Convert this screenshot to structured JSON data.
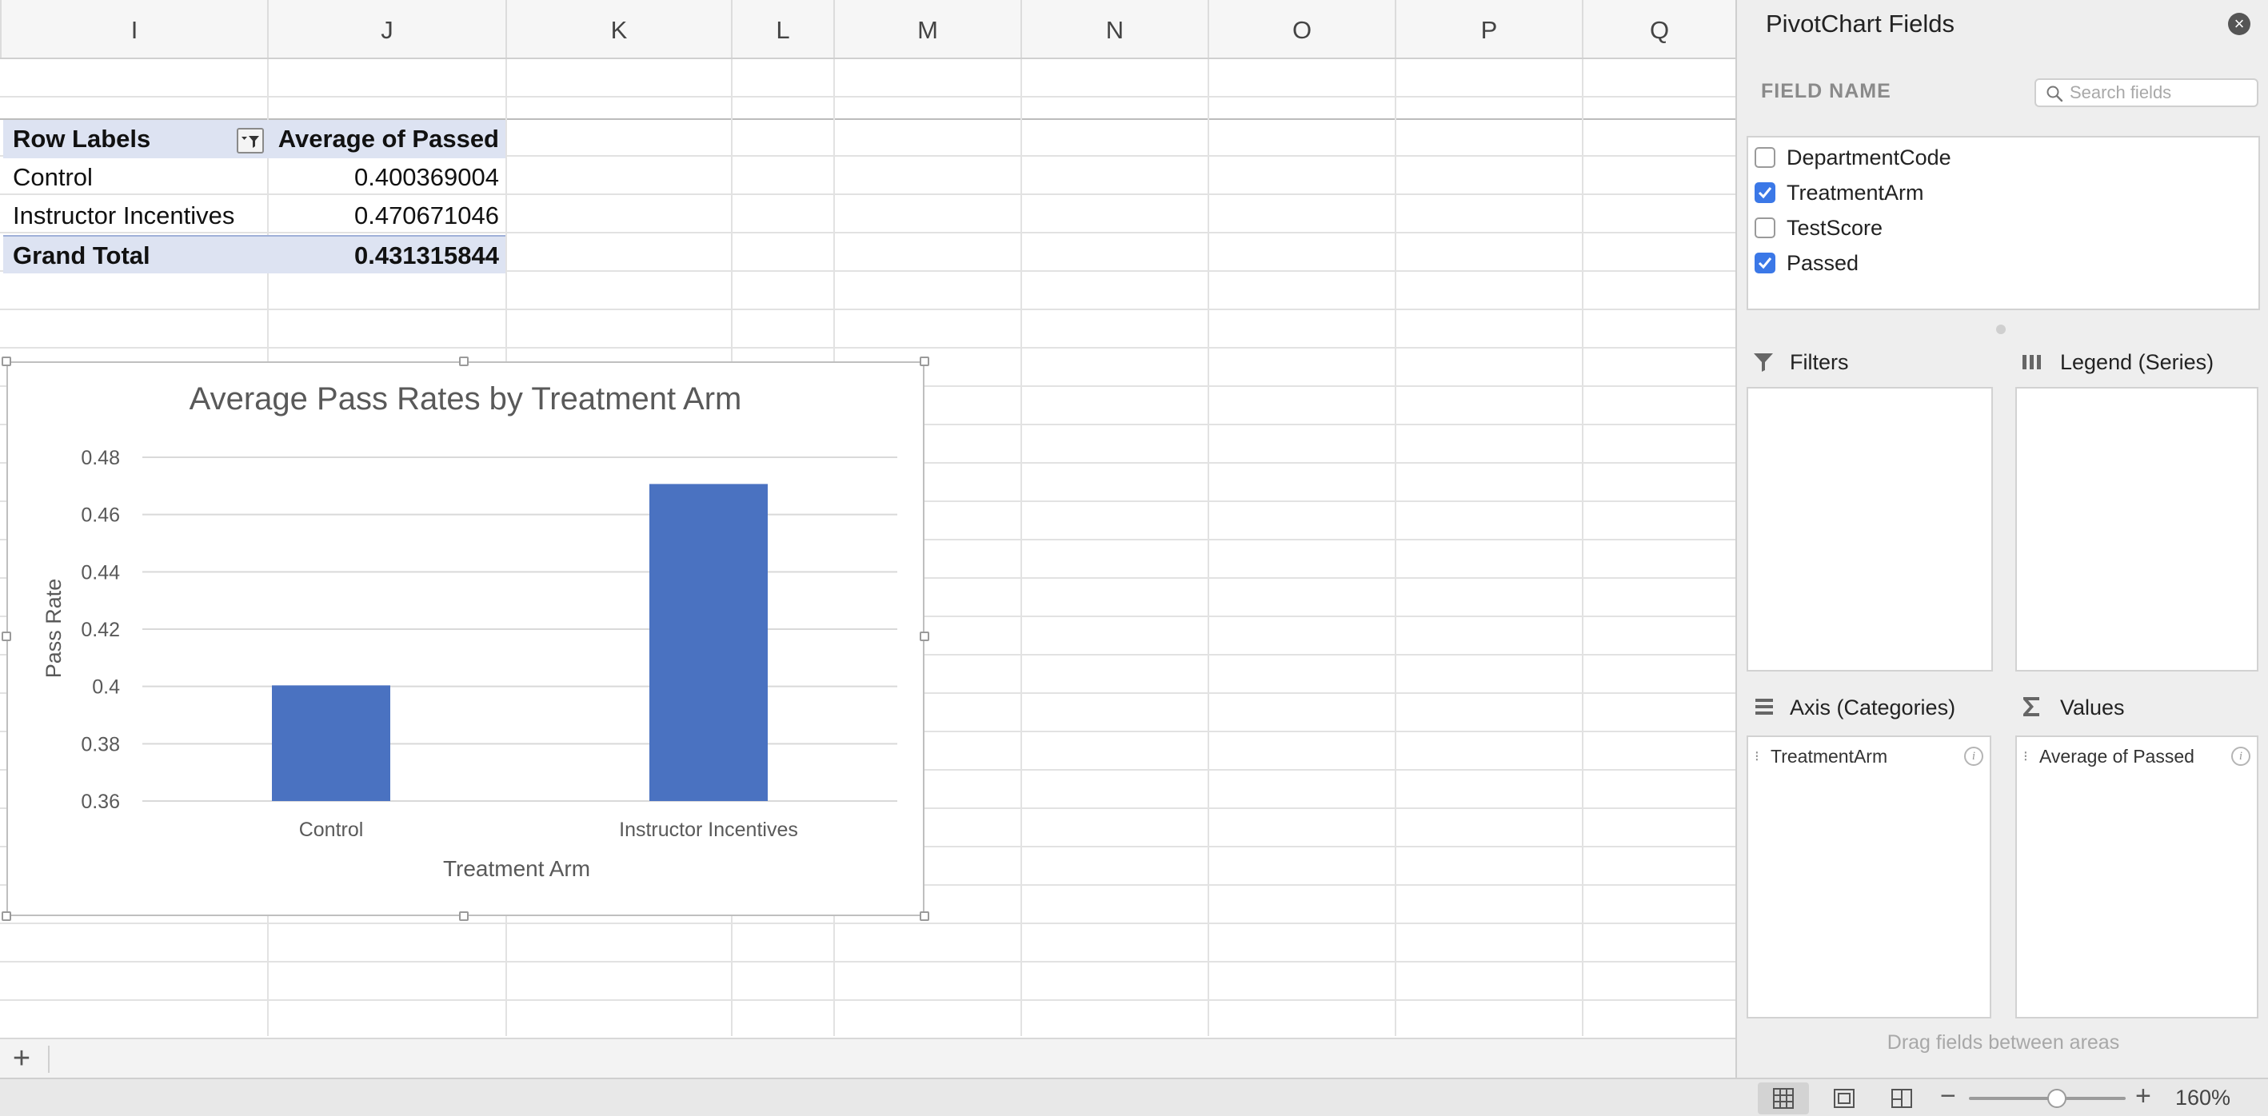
{
  "columns": [
    "I",
    "J",
    "K",
    "L",
    "M",
    "N",
    "O",
    "P",
    "Q"
  ],
  "pivot_table": {
    "header": {
      "row_labels": "Row Labels",
      "value_header": "Average of Passed"
    },
    "rows": [
      {
        "label": "Control",
        "value": "0.400369004"
      },
      {
        "label": "Instructor Incentives",
        "value": "0.470671046"
      }
    ],
    "grand_total": {
      "label": "Grand Total",
      "value": "0.431315844"
    }
  },
  "chart_data": {
    "type": "bar",
    "title": "Average Pass Rates by Treatment Arm",
    "xlabel": "Treatment Arm",
    "ylabel": "Pass Rate",
    "categories": [
      "Control",
      "Instructor Incentives"
    ],
    "values": [
      0.400369004,
      0.470671046
    ],
    "ylim": [
      0.36,
      0.48
    ],
    "yticks": [
      "0.48",
      "0.46",
      "0.44",
      "0.42",
      "0.4",
      "0.38",
      "0.36"
    ],
    "bar_color": "#4a72c1",
    "grid": true,
    "legend": "none"
  },
  "pane": {
    "title": "PivotChart Fields",
    "field_name_label": "FIELD NAME",
    "search_placeholder": "Search fields",
    "fields": [
      {
        "label": "DepartmentCode",
        "checked": false
      },
      {
        "label": "TreatmentArm",
        "checked": true
      },
      {
        "label": "TestScore",
        "checked": false
      },
      {
        "label": "Passed",
        "checked": true
      }
    ],
    "areas": {
      "filters": {
        "title": "Filters"
      },
      "legend": {
        "title": "Legend (Series)"
      },
      "axis": {
        "title": "Axis (Categories)",
        "items": [
          "TreatmentArm"
        ]
      },
      "values": {
        "title": "Values",
        "items": [
          "Average of Passed"
        ]
      }
    },
    "drag_hint": "Drag fields between areas"
  },
  "sheet_tabs": {
    "add_label": "+"
  },
  "status_bar": {
    "zoom_minus": "−",
    "zoom_plus": "+",
    "zoom_level": "160%"
  },
  "colors": {
    "accent": "#3b78e7",
    "pivot_header_bg": "#dde3f2"
  }
}
